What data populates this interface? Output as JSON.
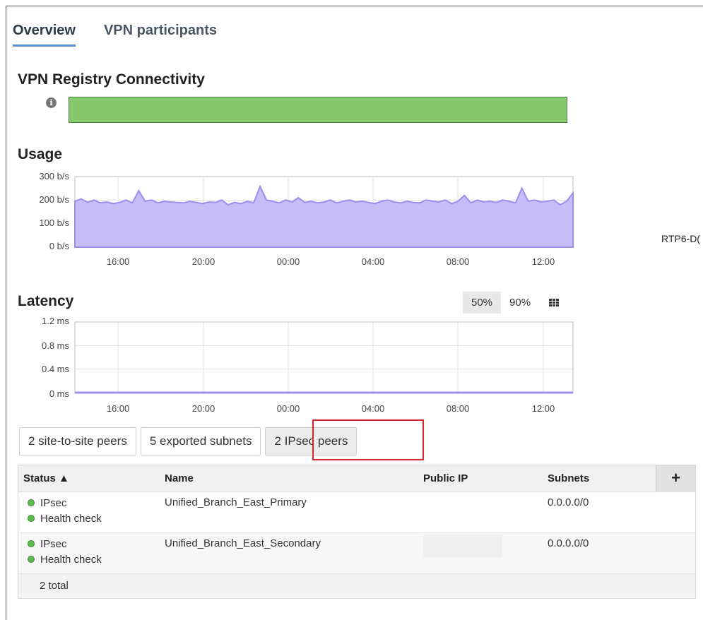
{
  "tabs": [
    {
      "label": "Overview",
      "active": true
    },
    {
      "label": "VPN participants",
      "active": false
    }
  ],
  "registry": {
    "title": "VPN Registry Connectivity",
    "status_color": "#86c86e"
  },
  "usage": {
    "title": "Usage",
    "y_ticks": [
      "300 b/s",
      "200 b/s",
      "100 b/s",
      "0 b/s"
    ],
    "x_ticks": [
      "16:00",
      "20:00",
      "00:00",
      "04:00",
      "08:00",
      "12:00"
    ]
  },
  "side_label": "RTP6-D(",
  "latency": {
    "title": "Latency",
    "toggle": [
      "50%",
      "90%"
    ],
    "y_ticks": [
      "1.2 ms",
      "0.8 ms",
      "0.4 ms",
      "0 ms"
    ],
    "x_ticks": [
      "16:00",
      "20:00",
      "00:00",
      "04:00",
      "08:00",
      "12:00"
    ]
  },
  "chart_data": [
    {
      "type": "area",
      "title": "Usage",
      "ylabel": "",
      "ylim": [
        0,
        300
      ],
      "y_unit": "b/s",
      "x_tick_labels": [
        "16:00",
        "20:00",
        "00:00",
        "04:00",
        "08:00",
        "12:00"
      ],
      "color": "#9b8ef0",
      "values": [
        195,
        205,
        190,
        200,
        188,
        192,
        185,
        190,
        200,
        188,
        240,
        195,
        200,
        188,
        195,
        192,
        190,
        188,
        195,
        190,
        185,
        192,
        190,
        200,
        180,
        190,
        185,
        195,
        188,
        258,
        200,
        195,
        188,
        200,
        192,
        210,
        190,
        195,
        188,
        192,
        200,
        188,
        195,
        200,
        192,
        195,
        190,
        185,
        195,
        200,
        192,
        188,
        195,
        190,
        188,
        200,
        195,
        192,
        200,
        185,
        195,
        220,
        188,
        200,
        192,
        195,
        190,
        200,
        195,
        188,
        250,
        195,
        200,
        192,
        195,
        200,
        180,
        195,
        230
      ]
    },
    {
      "type": "line",
      "title": "Latency",
      "ylim": [
        0,
        1.2
      ],
      "y_unit": "ms",
      "x_tick_labels": [
        "16:00",
        "20:00",
        "00:00",
        "04:00",
        "08:00",
        "12:00"
      ],
      "color": "#9b8ef0",
      "values": [
        0,
        0,
        0,
        0,
        0,
        0,
        0,
        0,
        0,
        0,
        0,
        0,
        0,
        0,
        0,
        0,
        0,
        0,
        0,
        0
      ]
    }
  ],
  "peer_buttons": [
    {
      "label": "2 site-to-site peers",
      "active": false
    },
    {
      "label": "5 exported subnets",
      "active": false
    },
    {
      "label": "2 IPsec peers",
      "active": true
    }
  ],
  "table": {
    "columns": [
      "Status ▲",
      "Name",
      "Public IP",
      "Subnets"
    ],
    "add_label": "+",
    "rows": [
      {
        "status1": "IPsec",
        "status2": "Health check",
        "name": "Unified_Branch_East_Primary",
        "ip": "",
        "subnets": "0.0.0.0/0"
      },
      {
        "status1": "IPsec",
        "status2": "Health check",
        "name": "Unified_Branch_East_Secondary",
        "ip": "",
        "subnets": "0.0.0.0/0"
      }
    ],
    "footer": "2 total"
  },
  "colors": {
    "accent_tab": "#5b8fc7",
    "ok_dot": "#5bbd4b",
    "highlight": "#d6242a"
  }
}
